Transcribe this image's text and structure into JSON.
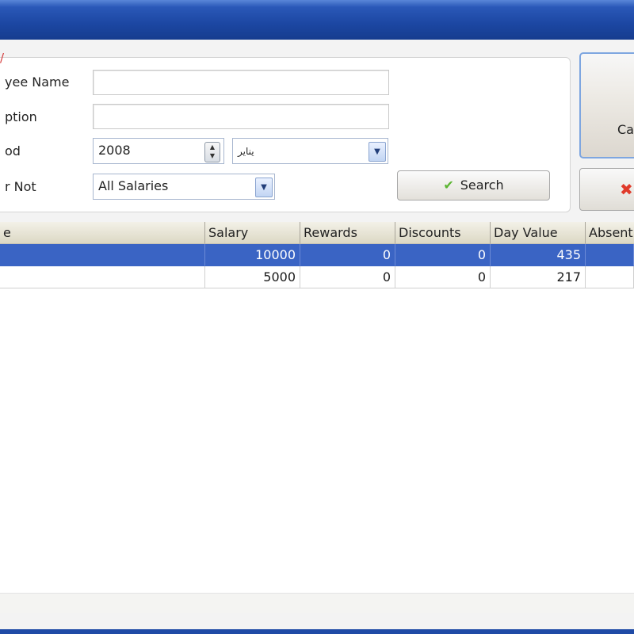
{
  "filters": {
    "mark": "/",
    "employee_name_label": "yee Name",
    "description_label": "ption",
    "period_label": "od",
    "not_label": "r Not",
    "year_value": "2008",
    "month_value": "يناير",
    "salaries_value": "All Salaries",
    "search_label": "Search"
  },
  "side": {
    "button1_label": "Ca",
    "button2_icon": "close-icon"
  },
  "grid": {
    "columns": [
      "e",
      "Salary",
      "Rewards",
      "Discounts",
      "Day Value",
      "Absent"
    ],
    "rows": [
      [
        "",
        "10000",
        "0",
        "0",
        "435",
        ""
      ],
      [
        "",
        "5000",
        "0",
        "0",
        "217",
        ""
      ]
    ]
  },
  "colors": {
    "title_bar": "#1c47a3",
    "selected_row": "#3a64c4",
    "check_icon": "#5bb531",
    "close_icon": "#e03a2a"
  }
}
